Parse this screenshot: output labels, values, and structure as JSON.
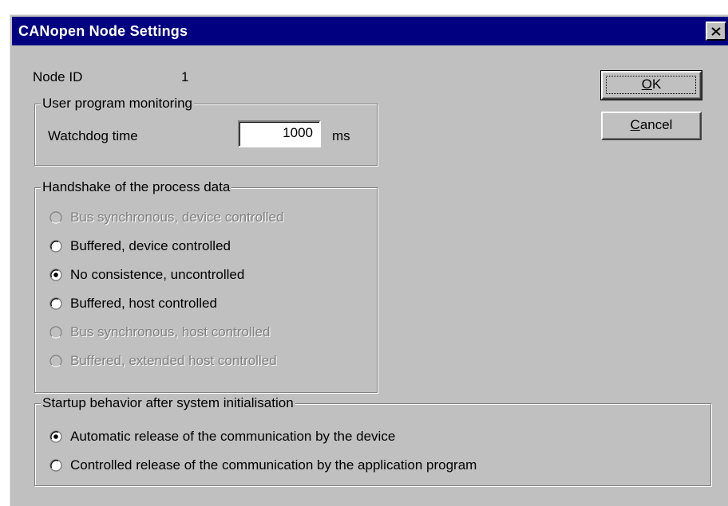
{
  "window": {
    "title": "CANopen Node Settings",
    "close_icon": "close-icon"
  },
  "node": {
    "label": "Node ID",
    "value": "1"
  },
  "user_program_monitoring": {
    "legend": "User program monitoring",
    "watchdog_label": "Watchdog time",
    "watchdog_value": "1000",
    "unit": "ms"
  },
  "handshake": {
    "legend": "Handshake of the process data",
    "options": [
      {
        "label": "Bus synchronous, device controlled",
        "enabled": false,
        "selected": false
      },
      {
        "label": "Buffered, device controlled",
        "enabled": true,
        "selected": false
      },
      {
        "label": "No consistence, uncontrolled",
        "enabled": true,
        "selected": true
      },
      {
        "label": "Buffered, host controlled",
        "enabled": true,
        "selected": false
      },
      {
        "label": "Bus synchronous, host controlled",
        "enabled": false,
        "selected": false
      },
      {
        "label": "Buffered, extended host controlled",
        "enabled": false,
        "selected": false
      }
    ]
  },
  "startup": {
    "legend": "Startup behavior after system initialisation",
    "options": [
      {
        "label": "Automatic release of the communication by the device",
        "enabled": true,
        "selected": true
      },
      {
        "label": "Controlled release of the communication by the application program",
        "enabled": true,
        "selected": false
      }
    ]
  },
  "buttons": {
    "ok_mnemonic": "O",
    "ok_rest": "K",
    "cancel_mnemonic": "C",
    "cancel_rest": "ancel"
  },
  "colors": {
    "face": "#c0c0c0",
    "titlebar": "#000080",
    "disabled_text": "#808080"
  }
}
